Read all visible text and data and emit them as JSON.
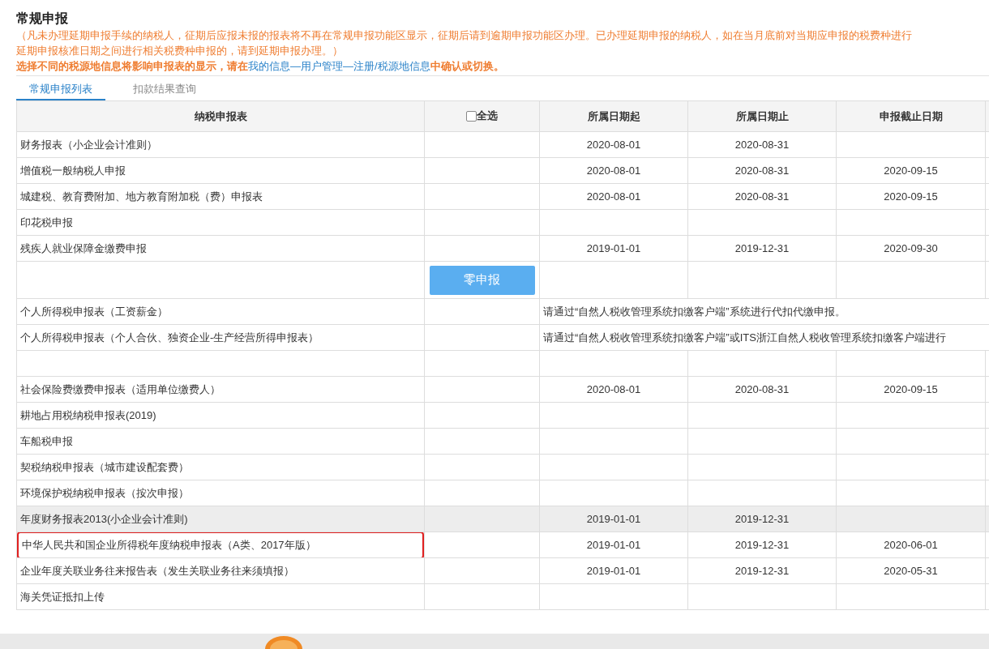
{
  "title": "常规申报",
  "notes": [
    "（凡未办理延期申报手续的纳税人，征期后应报未报的报表将不再在常规申报功能区显示，征期后请到逾期申报功能区办理。已办理延期申报的纳税人，如在当月底前对当期应申报的税费种进行",
    "延期申报核准日期之间进行相关税费种申报的，请到延期申报办理。）"
  ],
  "hint": [
    {
      "kind": "plain",
      "text": "选择不同的税源地信息将影响申报表的显示，请在"
    },
    {
      "kind": "link",
      "text": "我的信息—用户管理—注册/税源地信息"
    },
    {
      "kind": "plain",
      "text": "中确认或切换。"
    }
  ],
  "tabs": [
    {
      "label": "常规申报列表",
      "selected": true
    },
    {
      "label": "扣款结果查询",
      "selected": false
    }
  ],
  "columns": [
    "纳税申报表",
    "全选",
    "所属日期起",
    "所属日期止",
    "申报截止日期"
  ],
  "select_all": {
    "checked": false
  },
  "rows": [
    {
      "kind": "dates",
      "name": "财务报表（小企业会计准则）",
      "start": "2020-08-01",
      "end": "2020-08-31",
      "highlighted": false,
      "shaded": false
    },
    {
      "kind": "dates",
      "name": "增值税一般纳税人申报",
      "start": "2020-08-01",
      "end": "2020-08-31",
      "deadline": "2020-09-15",
      "highlighted": false,
      "shaded": false
    },
    {
      "kind": "dates",
      "name": "城建税、教育费附加、地方教育附加税（费）申报表",
      "start": "2020-08-01",
      "end": "2020-08-31",
      "deadline": "2020-09-15",
      "highlighted": false,
      "shaded": false
    },
    {
      "kind": "dates",
      "name": "印花税申报",
      "highlighted": false,
      "shaded": false
    },
    {
      "kind": "dates",
      "name": "残疾人就业保障金缴费申报",
      "start": "2019-01-01",
      "end": "2019-12-31",
      "deadline": "2020-09-30",
      "highlighted": false,
      "shaded": false
    },
    {
      "kind": "zero",
      "button": "零申报"
    },
    {
      "kind": "notice",
      "name": "个人所得税申报表（工资薪金）",
      "notice": "请通过“自然人税收管理系统扣缴客户端”系统进行代扣代缴申报。"
    },
    {
      "kind": "notice",
      "name": "个人所得税申报表（个人合伙、独资企业-生产经营所得申报表）",
      "notice": "请通过“自然人税收管理系统扣缴客户端”或ITS浙江自然人税收管理系统扣缴客户端进行"
    },
    {
      "kind": "blank"
    },
    {
      "kind": "dates",
      "name": "社会保险费缴费申报表（适用单位缴费人）",
      "start": "2020-08-01",
      "end": "2020-08-31",
      "deadline": "2020-09-15",
      "highlighted": false,
      "shaded": false
    },
    {
      "kind": "dates",
      "name": "耕地占用税纳税申报表(2019)",
      "highlighted": false,
      "shaded": false
    },
    {
      "kind": "dates",
      "name": "车船税申报",
      "highlighted": false,
      "shaded": false
    },
    {
      "kind": "dates",
      "name": "契税纳税申报表（城市建设配套费）",
      "highlighted": false,
      "shaded": false
    },
    {
      "kind": "dates",
      "name": "环境保护税纳税申报表（按次申报）",
      "highlighted": false,
      "shaded": false
    },
    {
      "kind": "dates",
      "name": "年度财务报表2013(小企业会计准则)",
      "start": "2019-01-01",
      "end": "2019-12-31",
      "highlighted": false,
      "shaded": true
    },
    {
      "kind": "dates",
      "name": "中华人民共和国企业所得税年度纳税申报表（A类、2017年版）",
      "start": "2019-01-01",
      "end": "2019-12-31",
      "deadline": "2020-06-01",
      "highlighted": true,
      "shaded": false
    },
    {
      "kind": "dates",
      "name": "企业年度关联业务往来报告表（发生关联业务往来须填报）",
      "start": "2019-01-01",
      "end": "2019-12-31",
      "deadline": "2020-05-31",
      "highlighted": false,
      "shaded": false
    },
    {
      "kind": "dates",
      "name": "海关凭证抵扣上传",
      "highlighted": false,
      "shaded": false
    }
  ]
}
